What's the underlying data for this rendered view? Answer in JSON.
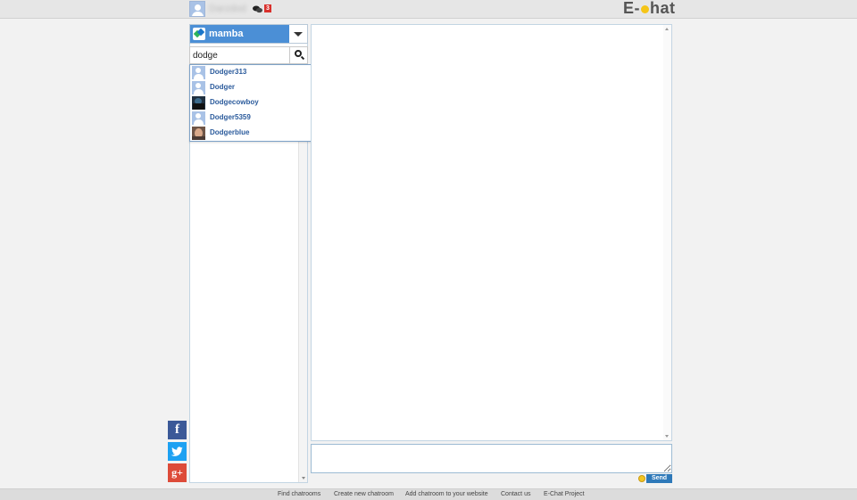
{
  "topbar": {
    "username": "Darzdod",
    "message_count": "3",
    "logo": {
      "prefix": "E-",
      "suffix": "hat"
    }
  },
  "room": {
    "name": "mamba"
  },
  "search": {
    "value": "dodge",
    "placeholder": ""
  },
  "results": [
    {
      "name": "Dodger313",
      "avatar": "default"
    },
    {
      "name": "Dodger",
      "avatar": "default"
    },
    {
      "name": "Dodgecowboy",
      "avatar": "dark"
    },
    {
      "name": "Dodger5359",
      "avatar": "default"
    },
    {
      "name": "Dodgerblue",
      "avatar": "face"
    }
  ],
  "chat": {
    "message_placeholder": "",
    "send_label": "Send"
  },
  "social": {
    "facebook": "f",
    "googleplus": "g+"
  },
  "footer": {
    "links": [
      "Find chatrooms",
      "Create new chatroom",
      "Add chatroom to your website",
      "Contact us",
      "E-Chat Project"
    ]
  },
  "colors": {
    "accent": "#4b8fd6",
    "send": "#2e79b9",
    "name_link": "#2b5b9c"
  }
}
